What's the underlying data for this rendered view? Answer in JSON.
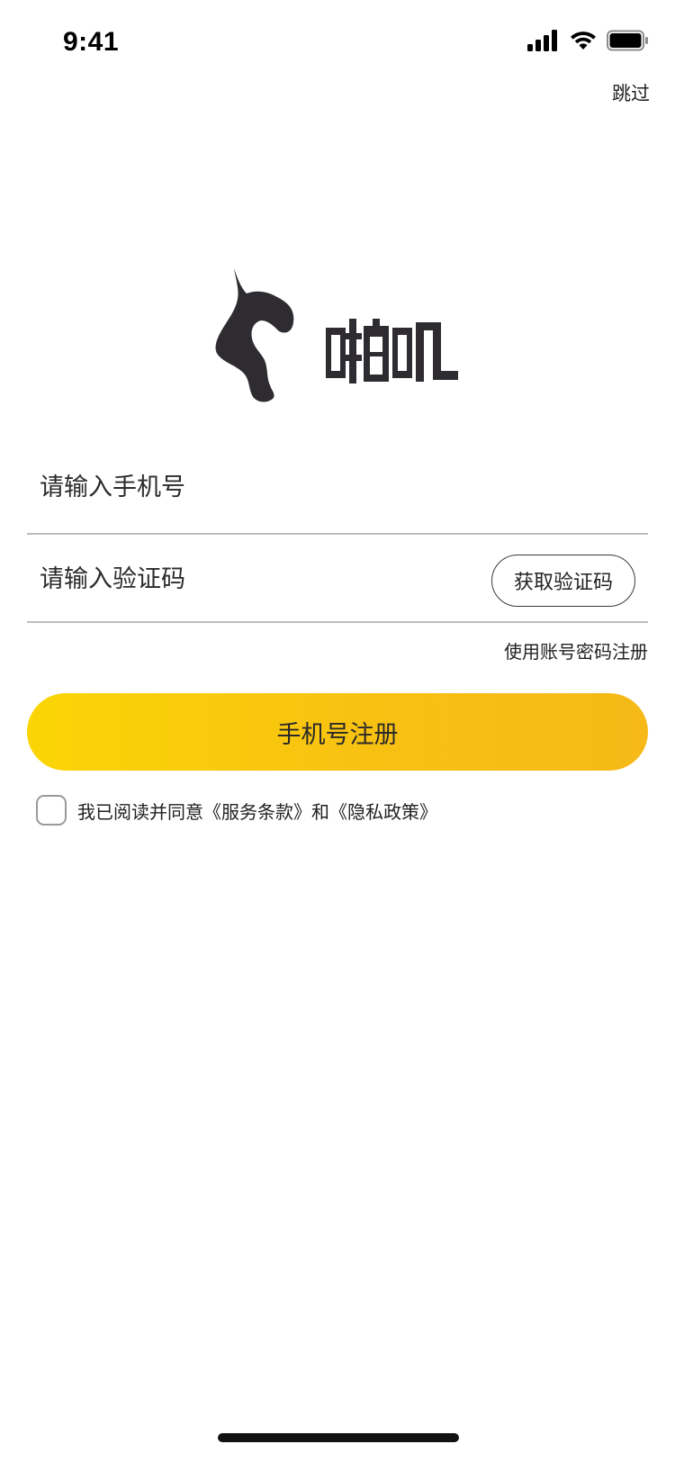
{
  "status_bar": {
    "time": "9:41",
    "icons": [
      "cellular-signal-icon",
      "wifi-icon",
      "battery-icon"
    ]
  },
  "header": {
    "skip_label": "跳过"
  },
  "logo": {
    "brand_text": "啪叽",
    "icon": "brand-logo-icon"
  },
  "form": {
    "phone_placeholder": "请输入手机号",
    "phone_value": "",
    "code_placeholder": "请输入验证码",
    "code_value": "",
    "get_code_label": "获取验证码",
    "account_register_link": "使用账号密码注册",
    "submit_label": "手机号注册"
  },
  "agreement": {
    "prefix": "我已阅读并同意",
    "terms_label": "《服务条款》",
    "conjunction": "和",
    "privacy_label": "《隐私政策》",
    "checked": false
  },
  "colors": {
    "primary_gradient_start": "#fbd505",
    "primary_gradient_end": "#f6b918",
    "logo_color": "#2e2c30",
    "divider": "#bdbdbd"
  }
}
